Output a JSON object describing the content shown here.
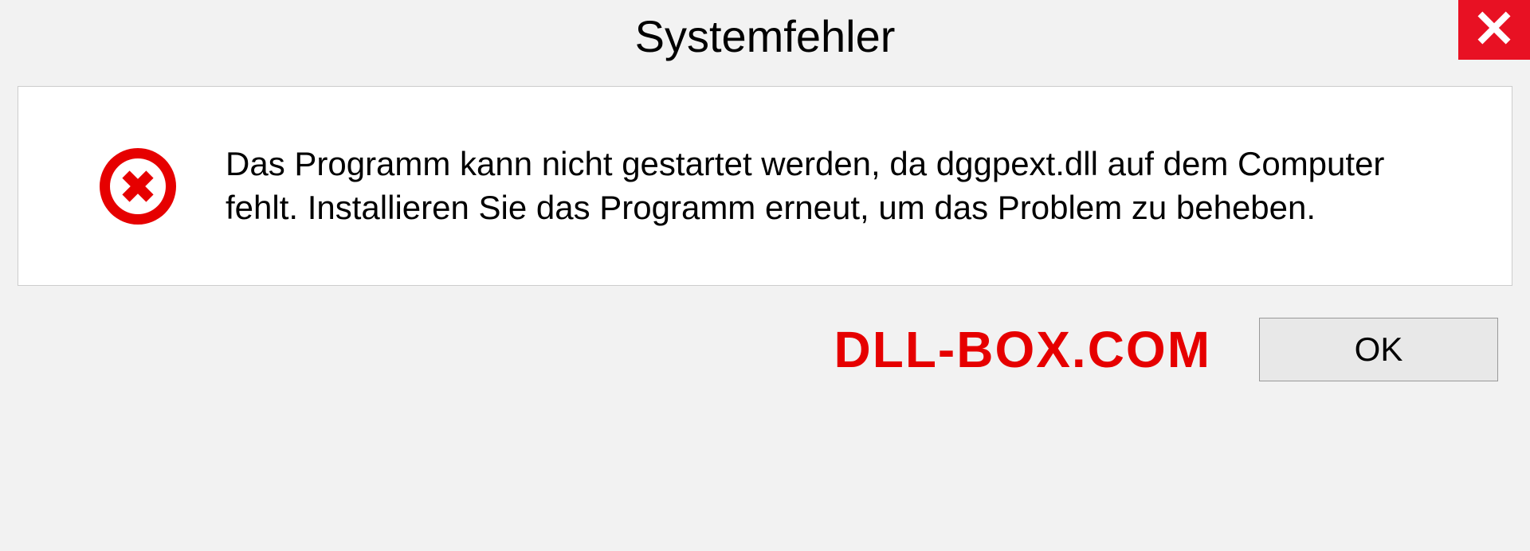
{
  "dialog": {
    "title": "Systemfehler",
    "message": "Das Programm kann nicht gestartet werden, da dggpext.dll auf dem Computer fehlt. Installieren Sie das Programm erneut, um das Problem zu beheben.",
    "ok_label": "OK"
  },
  "watermark": "DLL-BOX.COM"
}
